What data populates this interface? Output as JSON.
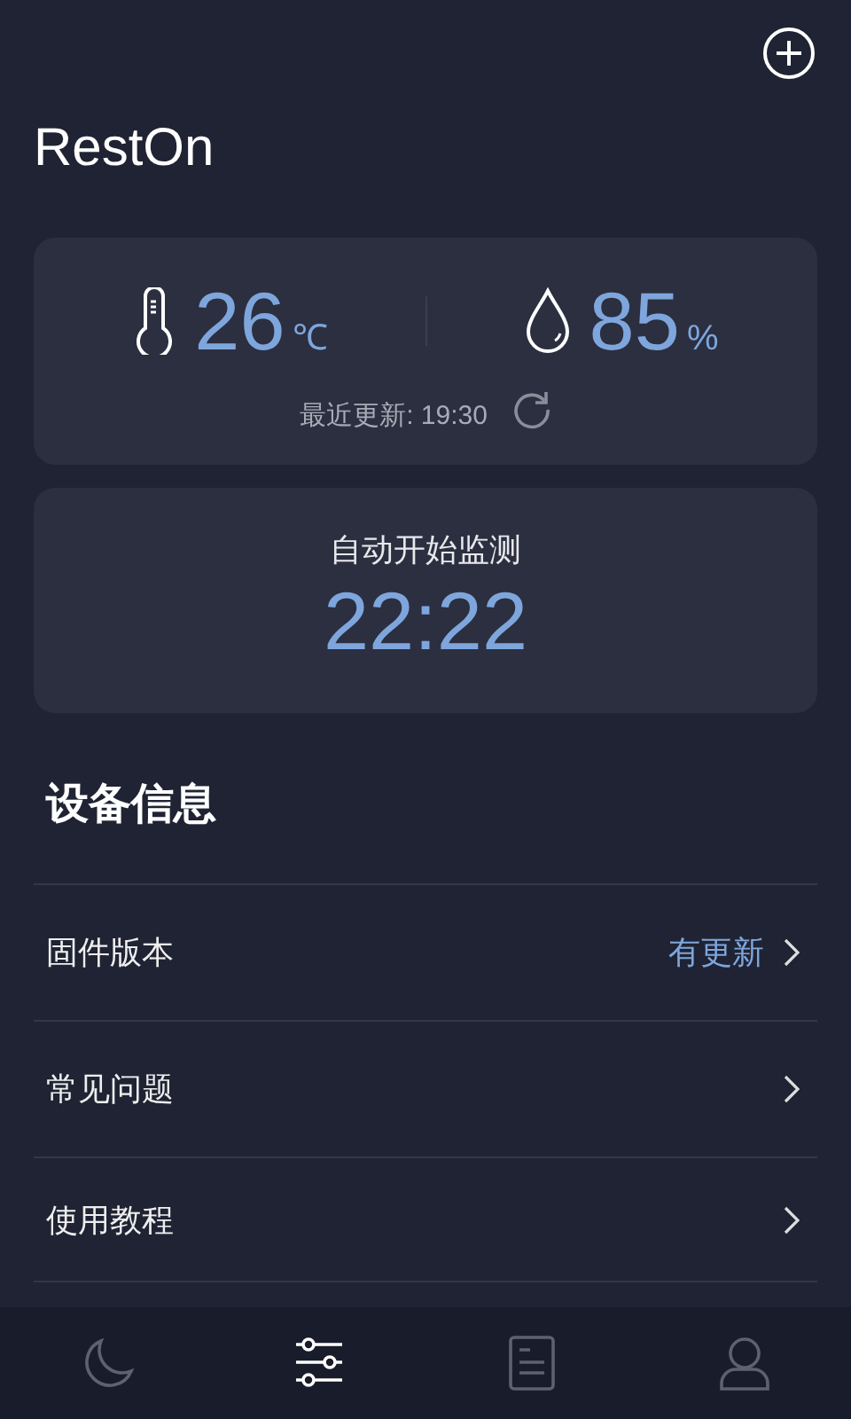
{
  "app": {
    "title": "RestOn"
  },
  "climate": {
    "temperature": {
      "value": "26",
      "unit": "℃"
    },
    "humidity": {
      "value": "85",
      "unit": "%"
    },
    "last_update": "最近更新: 19:30"
  },
  "monitor": {
    "label": "自动开始监测",
    "time": "22:22"
  },
  "device_info": {
    "heading": "设备信息",
    "items": [
      {
        "label": "固件版本",
        "badge": "有更新"
      },
      {
        "label": "常见问题"
      },
      {
        "label": "使用教程"
      }
    ]
  },
  "tabs": [
    {
      "kind": "sleep",
      "selected": false
    },
    {
      "kind": "controls",
      "selected": true
    },
    {
      "kind": "report",
      "selected": false
    },
    {
      "kind": "profile",
      "selected": false
    }
  ]
}
